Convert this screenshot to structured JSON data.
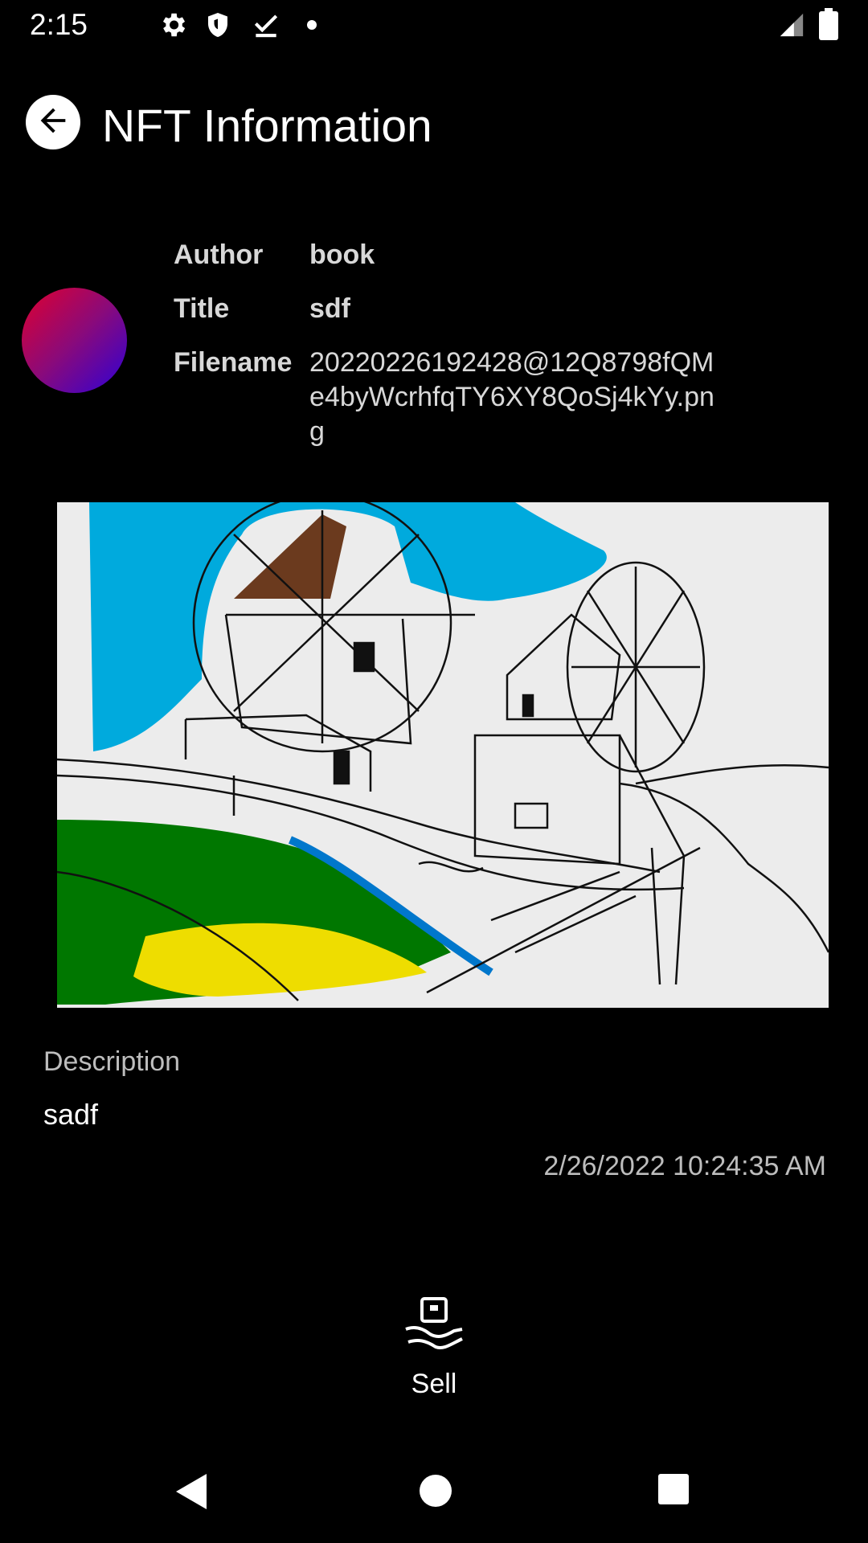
{
  "status_bar": {
    "time": "2:15",
    "icons": [
      "gear-icon",
      "shield-icon",
      "download-done-icon",
      "dot-icon",
      "signal-icon",
      "battery-icon"
    ]
  },
  "header": {
    "title": "NFT Information",
    "back_icon": "arrow-left-icon"
  },
  "info": {
    "author_label": "Author",
    "author_value": "book",
    "title_label": "Title",
    "title_value": "sdf",
    "filename_label": "Filename",
    "filename_value": "20220226192428@12Q8798fQMe4byWcrhfqTY6XY8QoSj4kYy.png"
  },
  "description": {
    "label": "Description",
    "text": "sadf",
    "timestamp": "2/26/2022 10:24:35 AM"
  },
  "actions": {
    "sell_label": "Sell",
    "sell_icon": "hand-sell-icon"
  },
  "nav": {
    "icons": [
      "back-triangle-icon",
      "home-circle-icon",
      "recents-square-icon"
    ]
  },
  "colors": {
    "background": "#000000",
    "avatar_start": "#e0002e",
    "avatar_end": "#2e00d6",
    "sky": "#00aadd",
    "grass": "#007700",
    "sand": "#eedd00",
    "roof": "#6b3a1e"
  }
}
